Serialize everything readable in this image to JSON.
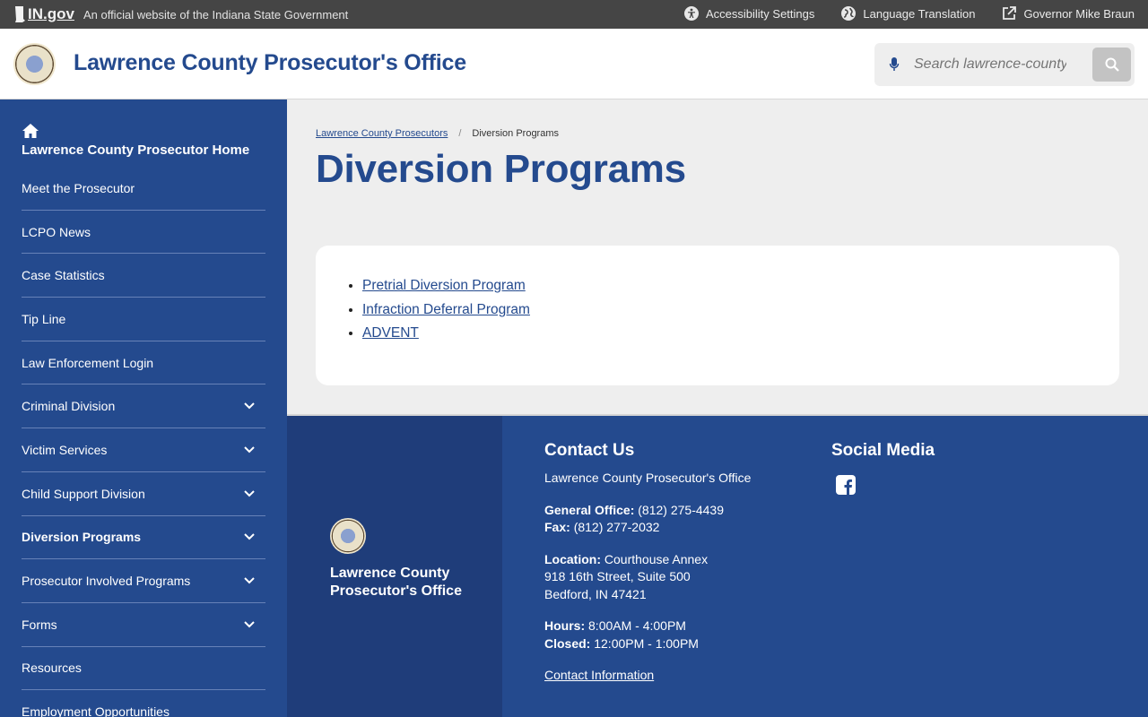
{
  "topbar": {
    "brand": "IN.gov",
    "official_text": "An official website of the Indiana State Government",
    "accessibility": "Accessibility Settings",
    "language": "Language Translation",
    "governor": "Governor Mike Braun"
  },
  "header": {
    "site_title": "Lawrence County Prosecutor's Office",
    "search_placeholder": "Search lawrence-county"
  },
  "sidebar": {
    "home_label": "Lawrence County Prosecutor Home",
    "items": [
      {
        "label": "Meet the Prosecutor",
        "expandable": false
      },
      {
        "label": "LCPO News",
        "expandable": false
      },
      {
        "label": "Case Statistics",
        "expandable": false
      },
      {
        "label": "Tip Line",
        "expandable": false
      },
      {
        "label": "Law Enforcement Login",
        "expandable": false
      },
      {
        "label": "Criminal Division",
        "expandable": true
      },
      {
        "label": "Victim Services",
        "expandable": true
      },
      {
        "label": "Child Support Division",
        "expandable": true
      },
      {
        "label": "Diversion Programs",
        "expandable": true,
        "active": true
      },
      {
        "label": "Prosecutor Involved Programs",
        "expandable": true
      },
      {
        "label": "Forms",
        "expandable": true
      },
      {
        "label": "Resources",
        "expandable": false
      },
      {
        "label": "Employment Opportunities",
        "expandable": false
      }
    ]
  },
  "breadcrumb": {
    "parent": "Lawrence County Prosecutors",
    "separator": "/",
    "current": "Diversion Programs"
  },
  "main": {
    "title": "Diversion Programs",
    "links": [
      "Pretrial Diversion Program",
      "Infraction Deferral Program",
      "ADVENT"
    ]
  },
  "footer": {
    "org_name": "Lawrence County Prosecutor's Office",
    "contact_heading": "Contact Us",
    "contact_org": "Lawrence County Prosecutor's Office",
    "general_label": "General Office:",
    "general_value": "(812) 275-4439",
    "fax_label": "Fax:",
    "fax_value": "(812) 277-2032",
    "location_label": "Location:",
    "location_line1": "Courthouse Annex",
    "location_line2": "918 16th Street, Suite 500",
    "location_line3": "Bedford, IN 47421",
    "hours_label": "Hours:",
    "hours_value": "8:00AM - 4:00PM",
    "closed_label": "Closed:",
    "closed_value": "12:00PM - 1:00PM",
    "contact_link": "Contact Information",
    "social_heading": "Social Media",
    "social_icons": [
      "facebook-icon"
    ]
  },
  "colors": {
    "brand_blue": "#244a8e",
    "footer_dark_blue": "#1f3d7a",
    "topbar": "#454545",
    "page_bg": "#eeeeee"
  }
}
